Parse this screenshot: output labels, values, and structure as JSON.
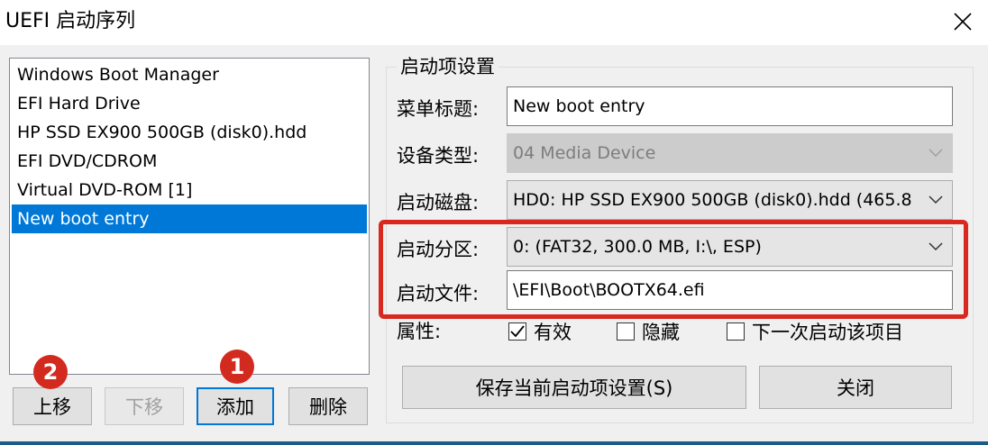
{
  "window": {
    "title": "UEFI 启动序列"
  },
  "boot_list": {
    "items": [
      "Windows Boot Manager",
      "EFI Hard Drive",
      "HP SSD EX900 500GB (disk0).hdd",
      "EFI DVD/CDROM",
      "Virtual DVD-ROM [1]",
      "New boot entry"
    ],
    "selected_index": 5
  },
  "list_buttons": {
    "move_up": "上移",
    "move_down": "下移",
    "add": "添加",
    "delete": "删除"
  },
  "badges": {
    "one": "1",
    "two": "2"
  },
  "settings": {
    "group_title": "启动项设置",
    "menu_title_label": "菜单标题:",
    "menu_title_value": "New boot entry",
    "device_type_label": "设备类型:",
    "device_type_value": "04  Media Device",
    "boot_disk_label": "启动磁盘:",
    "boot_disk_value": "HD0: HP SSD EX900 500GB (disk0).hdd (465.8",
    "boot_partition_label": "启动分区:",
    "boot_partition_value": "0: (FAT32, 300.0 MB, I:\\, ESP)",
    "boot_file_label": "启动文件:",
    "boot_file_value": "\\EFI\\Boot\\BOOTX64.efi",
    "attributes_label": "属性:",
    "attributes": [
      {
        "label": "有效",
        "checked": true
      },
      {
        "label": "隐藏",
        "checked": false
      },
      {
        "label": "下一次启动该项目",
        "checked": false
      }
    ]
  },
  "actions": {
    "save": "保存当前启动项设置(S)",
    "close": "关闭"
  },
  "icons": {
    "close": "close-icon",
    "dropdown": "chevron-down-icon",
    "check": "check-icon"
  },
  "colors": {
    "selection": "#0078d7",
    "highlight": "#d8281f",
    "badge": "#d32a1f"
  }
}
